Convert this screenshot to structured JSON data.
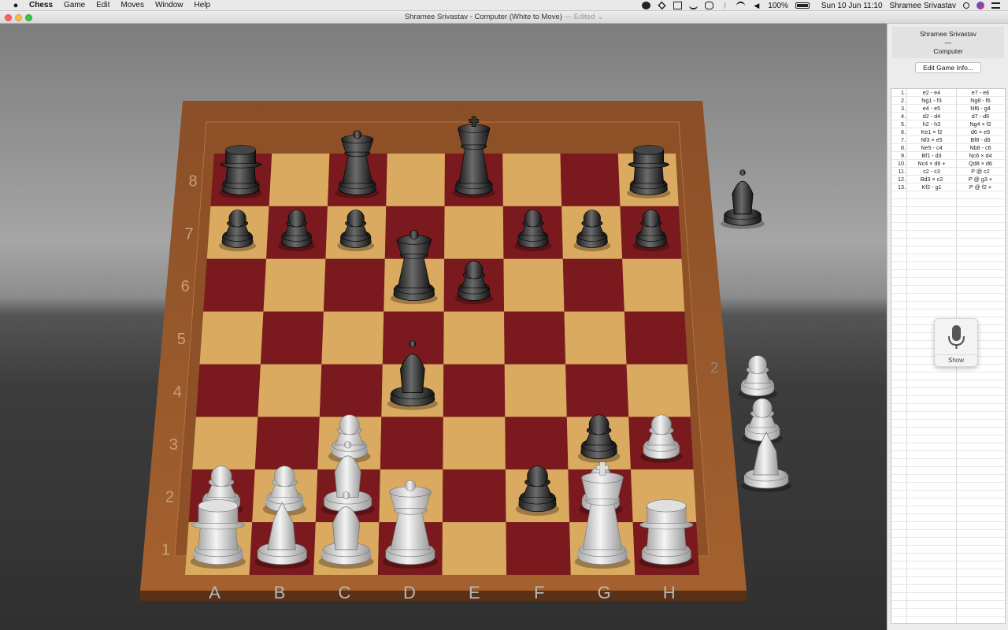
{
  "menubar": {
    "apple_icon": "apple-logo-icon",
    "items": [
      "Chess",
      "Game",
      "Edit",
      "Moves",
      "Window",
      "Help"
    ],
    "battery": "100%",
    "datetime": "Sun 10 Jun  11:10",
    "user": "Shramee Srivastav"
  },
  "window": {
    "title": "Shramee Srivastav - Computer   (White to Move)",
    "edited": "— Edited ⌄"
  },
  "board": {
    "files": [
      "A",
      "B",
      "C",
      "D",
      "E",
      "F",
      "G",
      "H"
    ],
    "ranks": [
      "1",
      "2",
      "3",
      "4",
      "5",
      "6",
      "7",
      "8"
    ],
    "captured_count_label": "2",
    "light_square": "#d9aa60",
    "dark_square": "#7a1a1e",
    "frame_color": "#9a5a30",
    "pieces": [
      {
        "side": "black",
        "type": "rook",
        "sq": "a8"
      },
      {
        "side": "black",
        "type": "queen",
        "sq": "c8"
      },
      {
        "side": "black",
        "type": "king",
        "sq": "e8"
      },
      {
        "side": "black",
        "type": "rook",
        "sq": "h8"
      },
      {
        "side": "black",
        "type": "pawn",
        "sq": "a7"
      },
      {
        "side": "black",
        "type": "pawn",
        "sq": "b7"
      },
      {
        "side": "black",
        "type": "pawn",
        "sq": "c7"
      },
      {
        "side": "black",
        "type": "pawn",
        "sq": "f7"
      },
      {
        "side": "black",
        "type": "pawn",
        "sq": "g7"
      },
      {
        "side": "black",
        "type": "pawn",
        "sq": "h7"
      },
      {
        "side": "black",
        "type": "queen",
        "sq": "d6"
      },
      {
        "side": "black",
        "type": "pawn",
        "sq": "e6"
      },
      {
        "side": "black",
        "type": "bishop",
        "sq": "d4"
      },
      {
        "side": "black",
        "type": "pawn",
        "sq": "g3"
      },
      {
        "side": "black",
        "type": "pawn",
        "sq": "f2"
      },
      {
        "side": "white",
        "type": "pawn",
        "sq": "c3"
      },
      {
        "side": "white",
        "type": "pawn",
        "sq": "h3"
      },
      {
        "side": "white",
        "type": "pawn",
        "sq": "a2"
      },
      {
        "side": "white",
        "type": "pawn",
        "sq": "b2"
      },
      {
        "side": "white",
        "type": "bishop",
        "sq": "c2"
      },
      {
        "side": "white",
        "type": "pawn",
        "sq": "g2"
      },
      {
        "side": "white",
        "type": "rook",
        "sq": "a1"
      },
      {
        "side": "white",
        "type": "knight",
        "sq": "b1"
      },
      {
        "side": "white",
        "type": "bishop",
        "sq": "c1"
      },
      {
        "side": "white",
        "type": "queen",
        "sq": "d1"
      },
      {
        "side": "white",
        "type": "king",
        "sq": "g1"
      },
      {
        "side": "white",
        "type": "rook",
        "sq": "h1"
      }
    ],
    "captured_by_white": [
      "black bishop"
    ],
    "captured_by_black": [
      "white pawn",
      "white pawn",
      "white knight"
    ]
  },
  "sidebar": {
    "player_white": "Shramee Srivastav",
    "separator": "—",
    "player_black": "Computer",
    "edit_button": "Edit Game Info...",
    "moves": [
      {
        "n": "1.",
        "w": "e2  -  e4",
        "b": "e7  -  e6"
      },
      {
        "n": "2.",
        "w": "Ng1  -  f3",
        "b": "Ng8  -  f6"
      },
      {
        "n": "3.",
        "w": "e4  -  e5",
        "b": "Nf6  -  g4"
      },
      {
        "n": "4.",
        "w": "d2  -  d4",
        "b": "d7  -  d6"
      },
      {
        "n": "5.",
        "w": "h2  -  h3",
        "b": "Ng4  ×  f2"
      },
      {
        "n": "6.",
        "w": "Ke1  ×  f2",
        "b": "d6  ×  e5"
      },
      {
        "n": "7.",
        "w": "Nf3  ×  e5",
        "b": "Bf8  -  d6"
      },
      {
        "n": "8.",
        "w": "Ne5  -  c4",
        "b": "Nb8  -  c6"
      },
      {
        "n": "9.",
        "w": "Bf1  -  d3",
        "b": "Nc6  ×  d4"
      },
      {
        "n": "10.",
        "w": "Nc4  ×  d6 +",
        "b": "Qd8  ×  d6"
      },
      {
        "n": "11.",
        "w": "c2  -  c3",
        "b": "P  @ c2"
      },
      {
        "n": "12.",
        "w": "Bd3  ×  c2",
        "b": "P  @ g3 +"
      },
      {
        "n": "13.",
        "w": "Kf2  -  g1",
        "b": "P  @ f2 +"
      }
    ]
  },
  "speech": {
    "icon": "microphone-icon",
    "label": "Show"
  }
}
